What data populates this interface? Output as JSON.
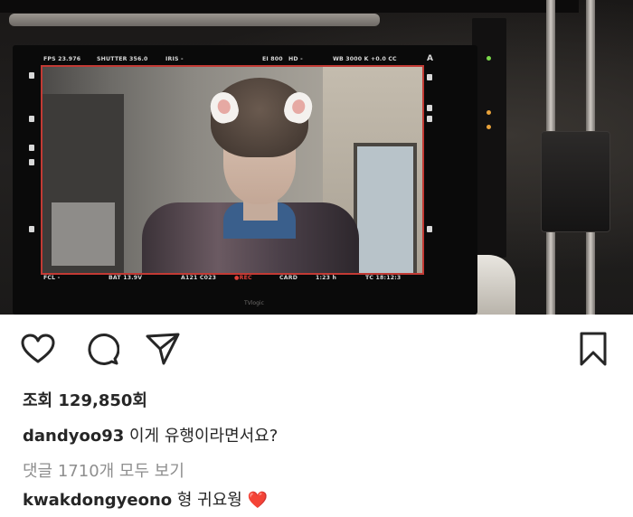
{
  "post": {
    "views_label": "조회",
    "views_count": "129,850회"
  },
  "caption": {
    "username": "dandyoo93",
    "text": "이게 유행이라면서요?"
  },
  "comments_link": "댓글 1710개 모두 보기",
  "comment": {
    "username": "kwakdongyeono",
    "text": "형 귀요웡",
    "emoji": "❤️",
    "emoji_color": "#ed1c24"
  },
  "monitor": {
    "brand": "TVlogic",
    "osd_top": {
      "fps": "FPS 23.976",
      "shutter": "SHUTTER 356.0",
      "iris": "IRIS -",
      "iso": "EI 800",
      "quality": "HD -",
      "wb": "WB 3000 K  +0.0 CC",
      "marker": "A"
    },
    "osd_bottom": {
      "lens": "FCL -",
      "battery": "BAT 13.9V",
      "clip": "A121 C023",
      "rec": "●REC",
      "card": "CARD",
      "remaining": "1:23 h",
      "timecode": "TC 18:12:3"
    }
  },
  "icons": [
    "heart-icon",
    "comment-icon",
    "share-icon",
    "bookmark-icon"
  ],
  "colors": {
    "text": "#262626",
    "muted": "#8e8e8e",
    "rec_red": "#e0413a"
  }
}
